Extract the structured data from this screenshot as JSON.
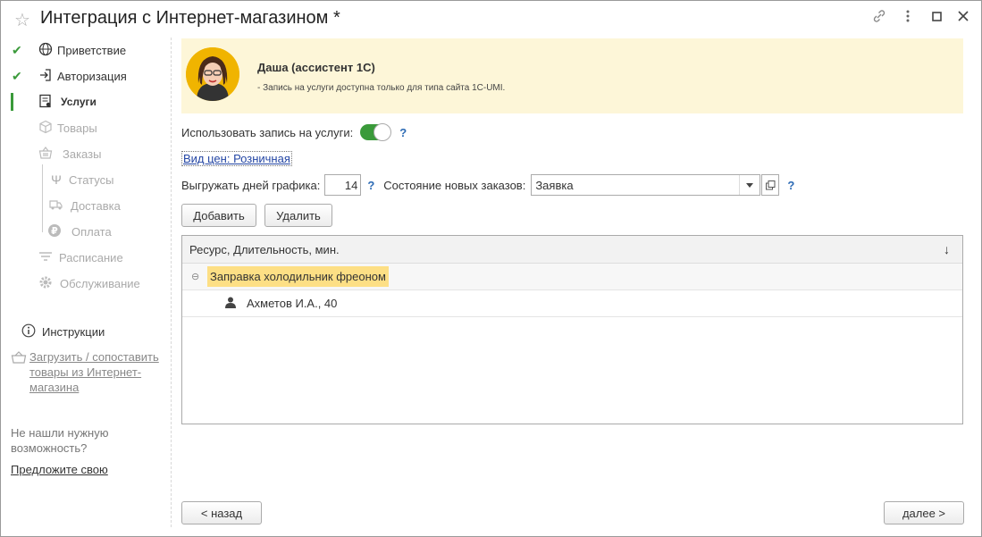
{
  "window": {
    "title": "Интеграция с Интернет-магазином *"
  },
  "sidebar": {
    "items": [
      {
        "label": "Приветствие",
        "icon": "globe-icon",
        "state": "done"
      },
      {
        "label": "Авторизация",
        "icon": "login-icon",
        "state": "done"
      },
      {
        "label": "Услуги",
        "icon": "certificate-icon",
        "state": "active"
      },
      {
        "label": "Товары",
        "icon": "box-icon",
        "state": "disabled"
      },
      {
        "label": "Заказы",
        "icon": "basket-icon",
        "state": "disabled"
      },
      {
        "label": "Статусы",
        "icon": "trident-icon",
        "state": "disabled"
      },
      {
        "label": "Доставка",
        "icon": "truck-icon",
        "state": "disabled"
      },
      {
        "label": "Оплата",
        "icon": "ruble-icon",
        "state": "disabled"
      },
      {
        "label": "Расписание",
        "icon": "filter-icon",
        "state": "disabled"
      },
      {
        "label": "Обслуживание",
        "icon": "gear-icon",
        "state": "disabled"
      }
    ],
    "instructions_label": "Инструкции",
    "load_link": "Загрузить / сопоставить товары из Интернет-магазина",
    "hint": "Не нашли нужную возможность?",
    "suggest_link": "Предложите свою"
  },
  "assistant": {
    "name": "Даша (ассистент 1С)",
    "message": "- Запись на услуги доступна только для типа сайта 1С-UMI."
  },
  "form": {
    "use_booking_label": "Использовать запись на услуги:",
    "use_booking_on": true,
    "price_type_link": "Вид цен: Розничная",
    "days_label": "Выгружать дней графика:",
    "days_value": "14",
    "order_state_label": "Состояние новых заказов:",
    "order_state_value": "Заявка",
    "help": "?"
  },
  "buttons": {
    "add": "Добавить",
    "delete": "Удалить",
    "back": "< назад",
    "next": "далее >"
  },
  "table": {
    "header": "Ресурс, Длительность, мин.",
    "sort_indicator": "↓",
    "group": "Заправка холодильник фреоном",
    "rows": [
      "Ахметов И.А., 40"
    ]
  },
  "colors": {
    "accent_green": "#3a9a3a",
    "assistant_bg": "#fdf6d8",
    "highlight": "#fddf85",
    "link_blue": "#2446a4"
  }
}
